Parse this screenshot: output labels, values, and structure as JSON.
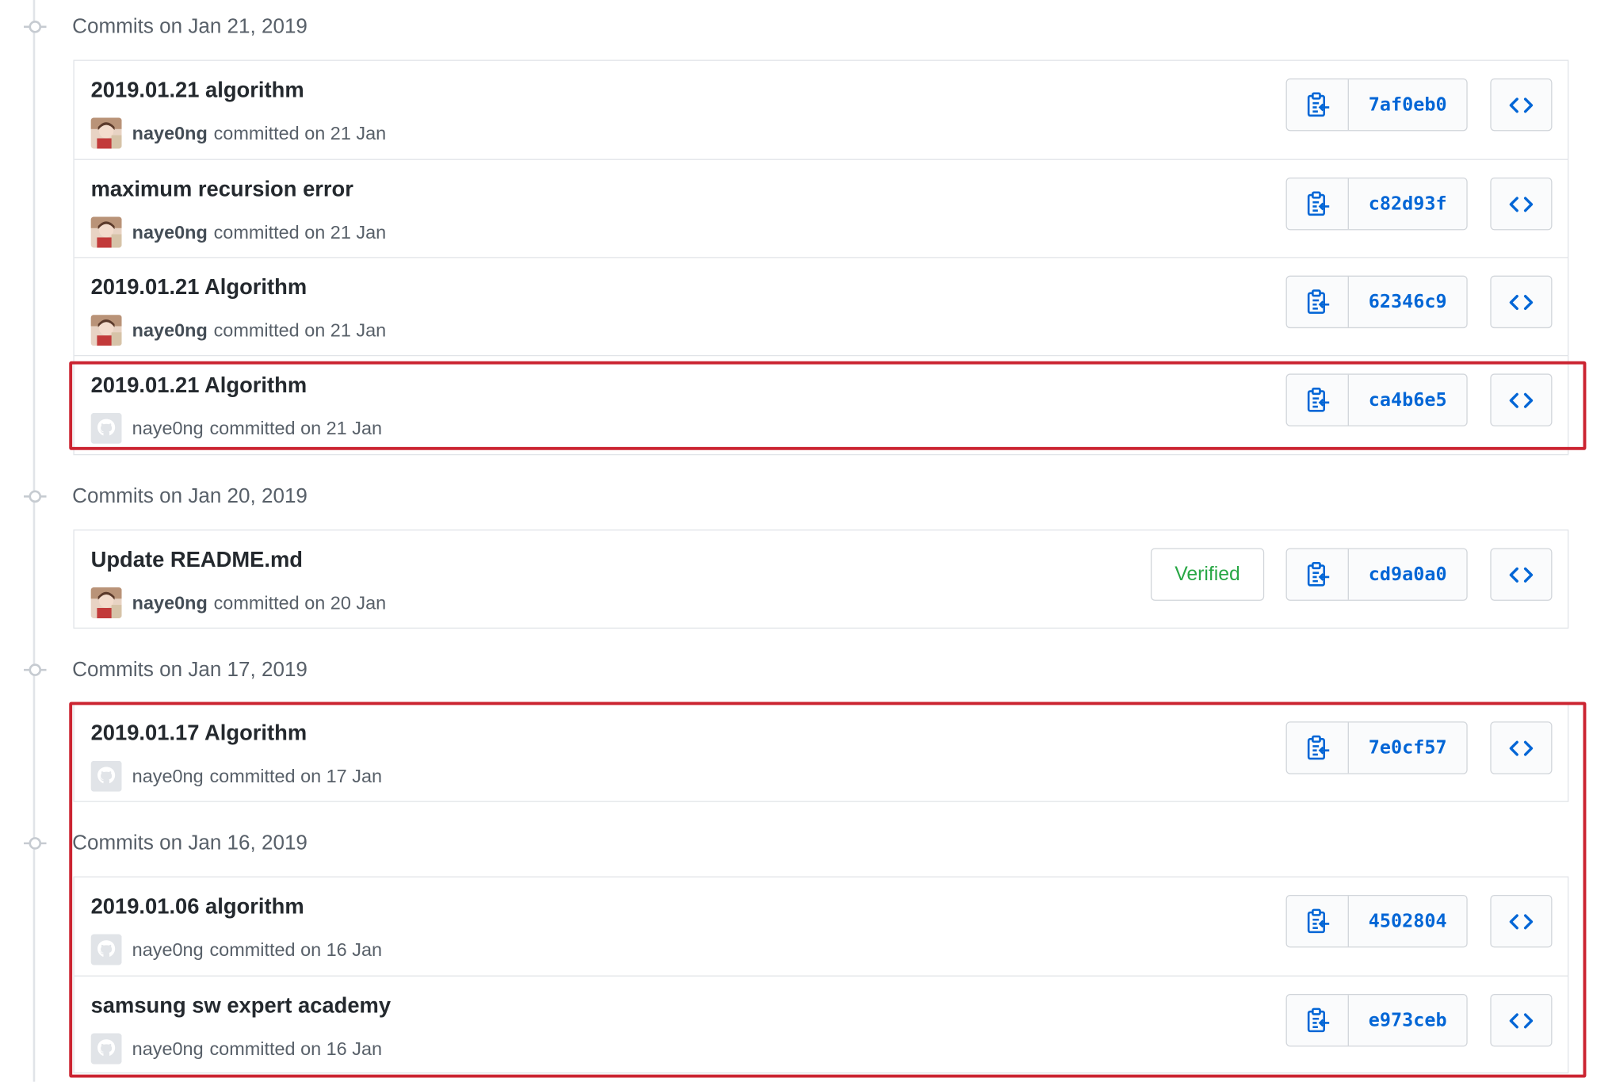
{
  "groups": [
    {
      "date": "Commits on Jan 21, 2019",
      "commits": [
        {
          "message": "2019.01.21 algorithm",
          "author": "naye0ng",
          "when": "committed on 21 Jan",
          "sha": "7af0eb0",
          "avatar": "photo"
        },
        {
          "message": "maximum recursion error",
          "author": "naye0ng",
          "when": "committed on 21 Jan",
          "sha": "c82d93f",
          "avatar": "photo"
        },
        {
          "message": "2019.01.21 Algorithm",
          "author": "naye0ng",
          "when": "committed on 21 Jan",
          "sha": "62346c9",
          "avatar": "photo"
        },
        {
          "message": "2019.01.21 Algorithm",
          "author": "naye0ng",
          "when": "committed on 21 Jan",
          "sha": "ca4b6e5",
          "avatar": "github-default"
        }
      ]
    },
    {
      "date": "Commits on Jan 20, 2019",
      "commits": [
        {
          "message": "Update README.md",
          "author": "naye0ng",
          "when": "committed on 20 Jan",
          "sha": "cd9a0a0",
          "avatar": "photo",
          "badge": "Verified"
        }
      ]
    },
    {
      "date": "Commits on Jan 17, 2019",
      "commits": [
        {
          "message": "2019.01.17 Algorithm",
          "author": "naye0ng",
          "when": "committed on 17 Jan",
          "sha": "7e0cf57",
          "avatar": "github-default"
        }
      ]
    },
    {
      "date": "Commits on Jan 16, 2019",
      "commits": [
        {
          "message": "2019.01.06 algorithm",
          "author": "naye0ng",
          "when": "committed on 16 Jan",
          "sha": "4502804",
          "avatar": "github-default"
        },
        {
          "message": "samsung sw expert academy",
          "author": "naye0ng",
          "when": "committed on 16 Jan",
          "sha": "e973ceb",
          "avatar": "github-default"
        }
      ]
    }
  ],
  "icons": {
    "clipboard": "clipboard-icon",
    "browse": "code-icon",
    "timeline": "git-commit-icon"
  },
  "colors": {
    "sha_link": "#0366d6",
    "verified": "#28a745",
    "highlight": "#cb2431"
  }
}
